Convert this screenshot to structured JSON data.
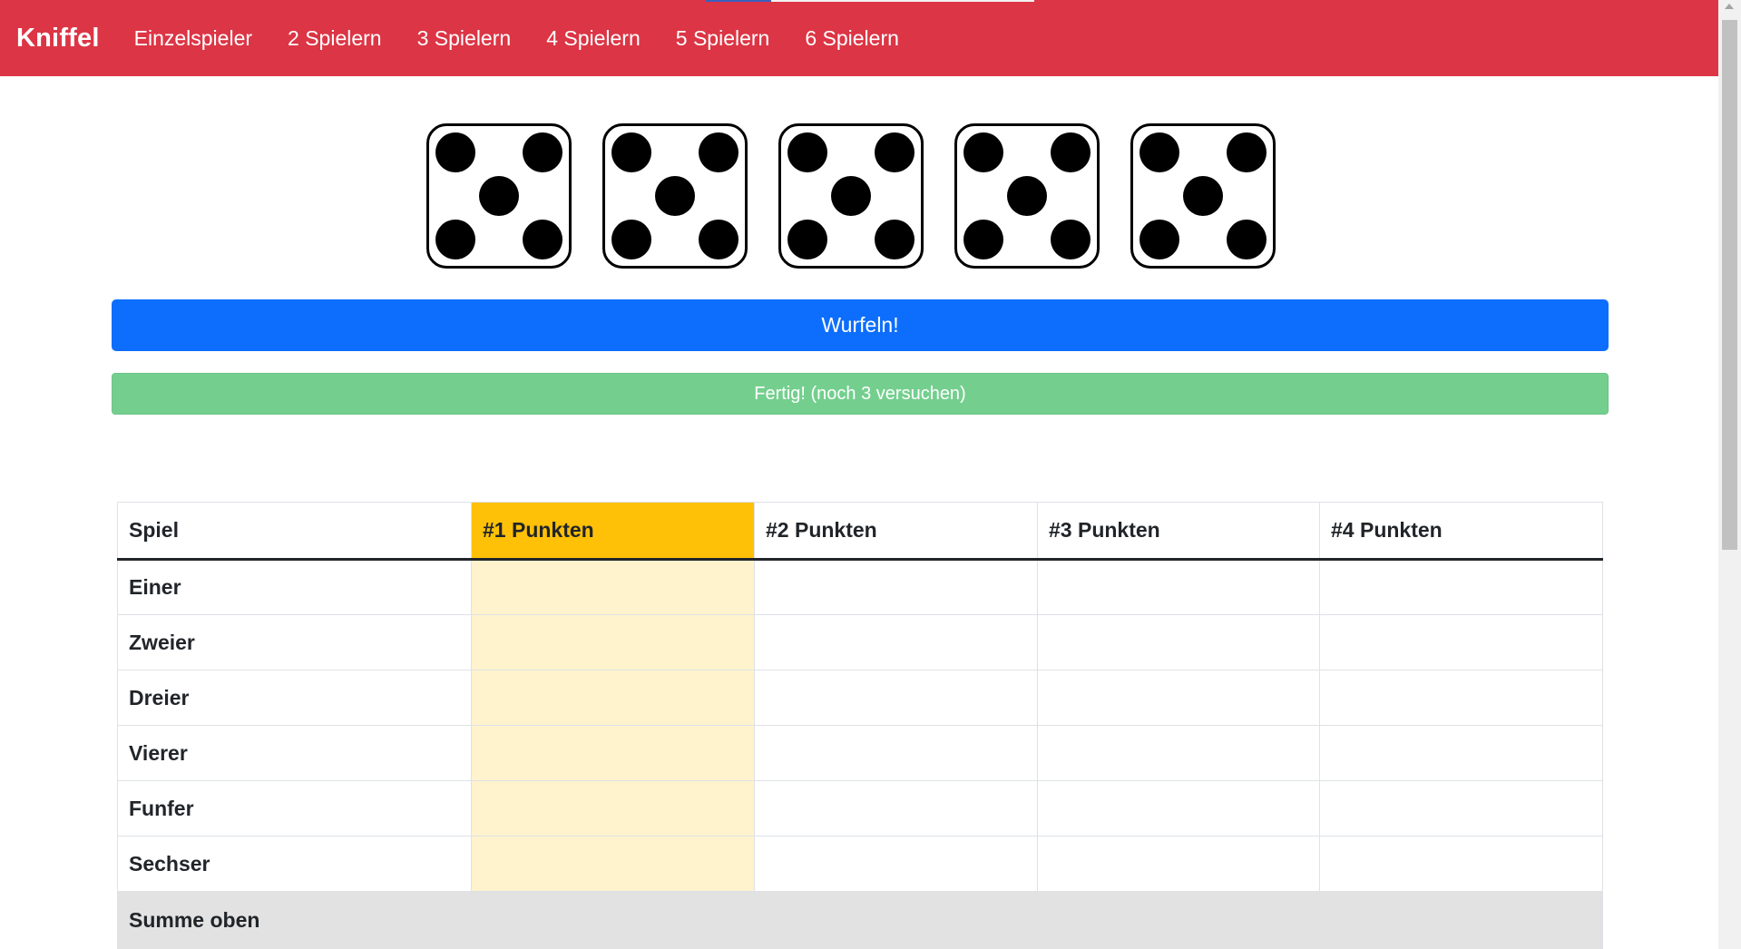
{
  "navbar": {
    "brand": "Kniffel",
    "items": [
      {
        "label": "Einzelspieler"
      },
      {
        "label": "2 Spielern"
      },
      {
        "label": "3 Spielern"
      },
      {
        "label": "4 Spielern"
      },
      {
        "label": "5 Spielern"
      },
      {
        "label": "6 Spielern"
      }
    ]
  },
  "dice": [
    5,
    5,
    5,
    5,
    5
  ],
  "buttons": {
    "roll_label": "Wurfeln!",
    "done_label": "Fertig! (noch 3 versuchen)"
  },
  "table": {
    "headers": [
      "Spiel",
      "#1 Punkten",
      "#2 Punkten",
      "#3 Punkten",
      "#4 Punkten"
    ],
    "active_player": 1,
    "rows": [
      {
        "label": "Einer",
        "scores": [
          "",
          "",
          "",
          ""
        ]
      },
      {
        "label": "Zweier",
        "scores": [
          "",
          "",
          "",
          ""
        ]
      },
      {
        "label": "Dreier",
        "scores": [
          "",
          "",
          "",
          ""
        ]
      },
      {
        "label": "Vierer",
        "scores": [
          "",
          "",
          "",
          ""
        ]
      },
      {
        "label": "Funfer",
        "scores": [
          "",
          "",
          "",
          ""
        ]
      },
      {
        "label": "Sechser",
        "scores": [
          "",
          "",
          "",
          ""
        ]
      }
    ],
    "sum_row": {
      "label": "Summe oben",
      "scores": [
        "",
        "",
        "",
        ""
      ]
    }
  },
  "colors": {
    "navbar": "#dc3545",
    "primary": "#0d6efd",
    "success": "#74cf8e",
    "active_header": "#ffc107",
    "active_cell": "#fff3cd"
  }
}
